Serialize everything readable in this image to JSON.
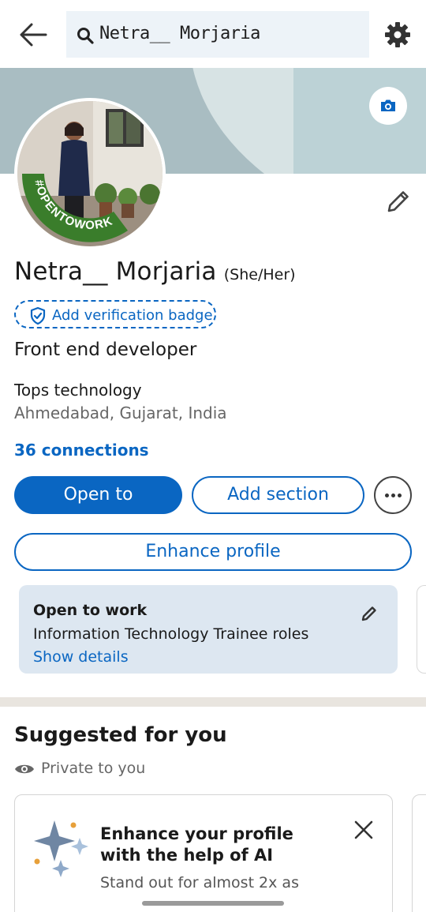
{
  "search": {
    "query": "Netra__ Morjaria"
  },
  "profile": {
    "name": "Netra__ Morjaria",
    "pronouns": "(She/Her)",
    "avatar_frame_text": "#OPENTOWORK",
    "verification_label": "Add verification badge",
    "headline": "Front end developer",
    "company": "Tops technology",
    "location": "Ahmedabad, Gujarat, India",
    "connections": "36 connections"
  },
  "actions": {
    "open_to": "Open to",
    "add_section": "Add section",
    "enhance_profile": "Enhance profile"
  },
  "open_to_work": {
    "title": "Open to work",
    "roles": "Information Technology Trainee roles",
    "link": "Show details"
  },
  "suggested": {
    "title": "Suggested for you",
    "privacy": "Private to you",
    "card": {
      "title": "Enhance your profile with the help of AI",
      "subtitle": "Stand out for almost 2x as"
    }
  },
  "colors": {
    "brand_blue": "#0a66c2",
    "open_to_work_green": "#3a7d2b",
    "card_bg": "#dde7f1"
  },
  "icons": [
    "back-arrow-icon",
    "search-icon",
    "gear-icon",
    "camera-icon",
    "pencil-icon",
    "shield-check-icon",
    "more-icon",
    "eye-icon",
    "sparkle-icon",
    "close-icon"
  ]
}
